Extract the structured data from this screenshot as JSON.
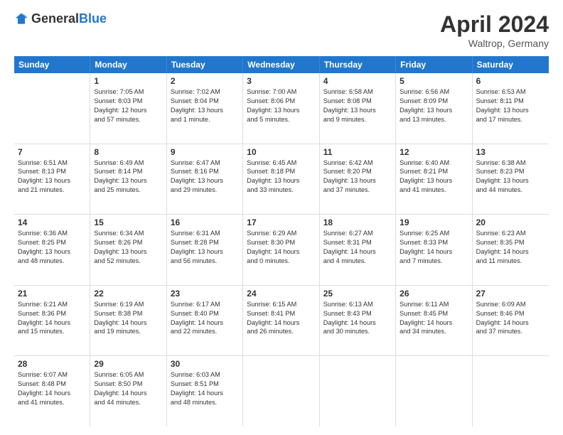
{
  "header": {
    "logo_general": "General",
    "logo_blue": "Blue",
    "month": "April 2024",
    "location": "Waltrop, Germany"
  },
  "days_of_week": [
    "Sunday",
    "Monday",
    "Tuesday",
    "Wednesday",
    "Thursday",
    "Friday",
    "Saturday"
  ],
  "weeks": [
    [
      {
        "day": "",
        "info": ""
      },
      {
        "day": "1",
        "info": "Sunrise: 7:05 AM\nSunset: 8:03 PM\nDaylight: 12 hours\nand 57 minutes."
      },
      {
        "day": "2",
        "info": "Sunrise: 7:02 AM\nSunset: 8:04 PM\nDaylight: 13 hours\nand 1 minute."
      },
      {
        "day": "3",
        "info": "Sunrise: 7:00 AM\nSunset: 8:06 PM\nDaylight: 13 hours\nand 5 minutes."
      },
      {
        "day": "4",
        "info": "Sunrise: 6:58 AM\nSunset: 8:08 PM\nDaylight: 13 hours\nand 9 minutes."
      },
      {
        "day": "5",
        "info": "Sunrise: 6:56 AM\nSunset: 8:09 PM\nDaylight: 13 hours\nand 13 minutes."
      },
      {
        "day": "6",
        "info": "Sunrise: 6:53 AM\nSunset: 8:11 PM\nDaylight: 13 hours\nand 17 minutes."
      }
    ],
    [
      {
        "day": "7",
        "info": "Sunrise: 6:51 AM\nSunset: 8:13 PM\nDaylight: 13 hours\nand 21 minutes."
      },
      {
        "day": "8",
        "info": "Sunrise: 6:49 AM\nSunset: 8:14 PM\nDaylight: 13 hours\nand 25 minutes."
      },
      {
        "day": "9",
        "info": "Sunrise: 6:47 AM\nSunset: 8:16 PM\nDaylight: 13 hours\nand 29 minutes."
      },
      {
        "day": "10",
        "info": "Sunrise: 6:45 AM\nSunset: 8:18 PM\nDaylight: 13 hours\nand 33 minutes."
      },
      {
        "day": "11",
        "info": "Sunrise: 6:42 AM\nSunset: 8:20 PM\nDaylight: 13 hours\nand 37 minutes."
      },
      {
        "day": "12",
        "info": "Sunrise: 6:40 AM\nSunset: 8:21 PM\nDaylight: 13 hours\nand 41 minutes."
      },
      {
        "day": "13",
        "info": "Sunrise: 6:38 AM\nSunset: 8:23 PM\nDaylight: 13 hours\nand 44 minutes."
      }
    ],
    [
      {
        "day": "14",
        "info": "Sunrise: 6:36 AM\nSunset: 8:25 PM\nDaylight: 13 hours\nand 48 minutes."
      },
      {
        "day": "15",
        "info": "Sunrise: 6:34 AM\nSunset: 8:26 PM\nDaylight: 13 hours\nand 52 minutes."
      },
      {
        "day": "16",
        "info": "Sunrise: 6:31 AM\nSunset: 8:28 PM\nDaylight: 13 hours\nand 56 minutes."
      },
      {
        "day": "17",
        "info": "Sunrise: 6:29 AM\nSunset: 8:30 PM\nDaylight: 14 hours\nand 0 minutes."
      },
      {
        "day": "18",
        "info": "Sunrise: 6:27 AM\nSunset: 8:31 PM\nDaylight: 14 hours\nand 4 minutes."
      },
      {
        "day": "19",
        "info": "Sunrise: 6:25 AM\nSunset: 8:33 PM\nDaylight: 14 hours\nand 7 minutes."
      },
      {
        "day": "20",
        "info": "Sunrise: 6:23 AM\nSunset: 8:35 PM\nDaylight: 14 hours\nand 11 minutes."
      }
    ],
    [
      {
        "day": "21",
        "info": "Sunrise: 6:21 AM\nSunset: 8:36 PM\nDaylight: 14 hours\nand 15 minutes."
      },
      {
        "day": "22",
        "info": "Sunrise: 6:19 AM\nSunset: 8:38 PM\nDaylight: 14 hours\nand 19 minutes."
      },
      {
        "day": "23",
        "info": "Sunrise: 6:17 AM\nSunset: 8:40 PM\nDaylight: 14 hours\nand 22 minutes."
      },
      {
        "day": "24",
        "info": "Sunrise: 6:15 AM\nSunset: 8:41 PM\nDaylight: 14 hours\nand 26 minutes."
      },
      {
        "day": "25",
        "info": "Sunrise: 6:13 AM\nSunset: 8:43 PM\nDaylight: 14 hours\nand 30 minutes."
      },
      {
        "day": "26",
        "info": "Sunrise: 6:11 AM\nSunset: 8:45 PM\nDaylight: 14 hours\nand 34 minutes."
      },
      {
        "day": "27",
        "info": "Sunrise: 6:09 AM\nSunset: 8:46 PM\nDaylight: 14 hours\nand 37 minutes."
      }
    ],
    [
      {
        "day": "28",
        "info": "Sunrise: 6:07 AM\nSunset: 8:48 PM\nDaylight: 14 hours\nand 41 minutes."
      },
      {
        "day": "29",
        "info": "Sunrise: 6:05 AM\nSunset: 8:50 PM\nDaylight: 14 hours\nand 44 minutes."
      },
      {
        "day": "30",
        "info": "Sunrise: 6:03 AM\nSunset: 8:51 PM\nDaylight: 14 hours\nand 48 minutes."
      },
      {
        "day": "",
        "info": ""
      },
      {
        "day": "",
        "info": ""
      },
      {
        "day": "",
        "info": ""
      },
      {
        "day": "",
        "info": ""
      }
    ]
  ]
}
